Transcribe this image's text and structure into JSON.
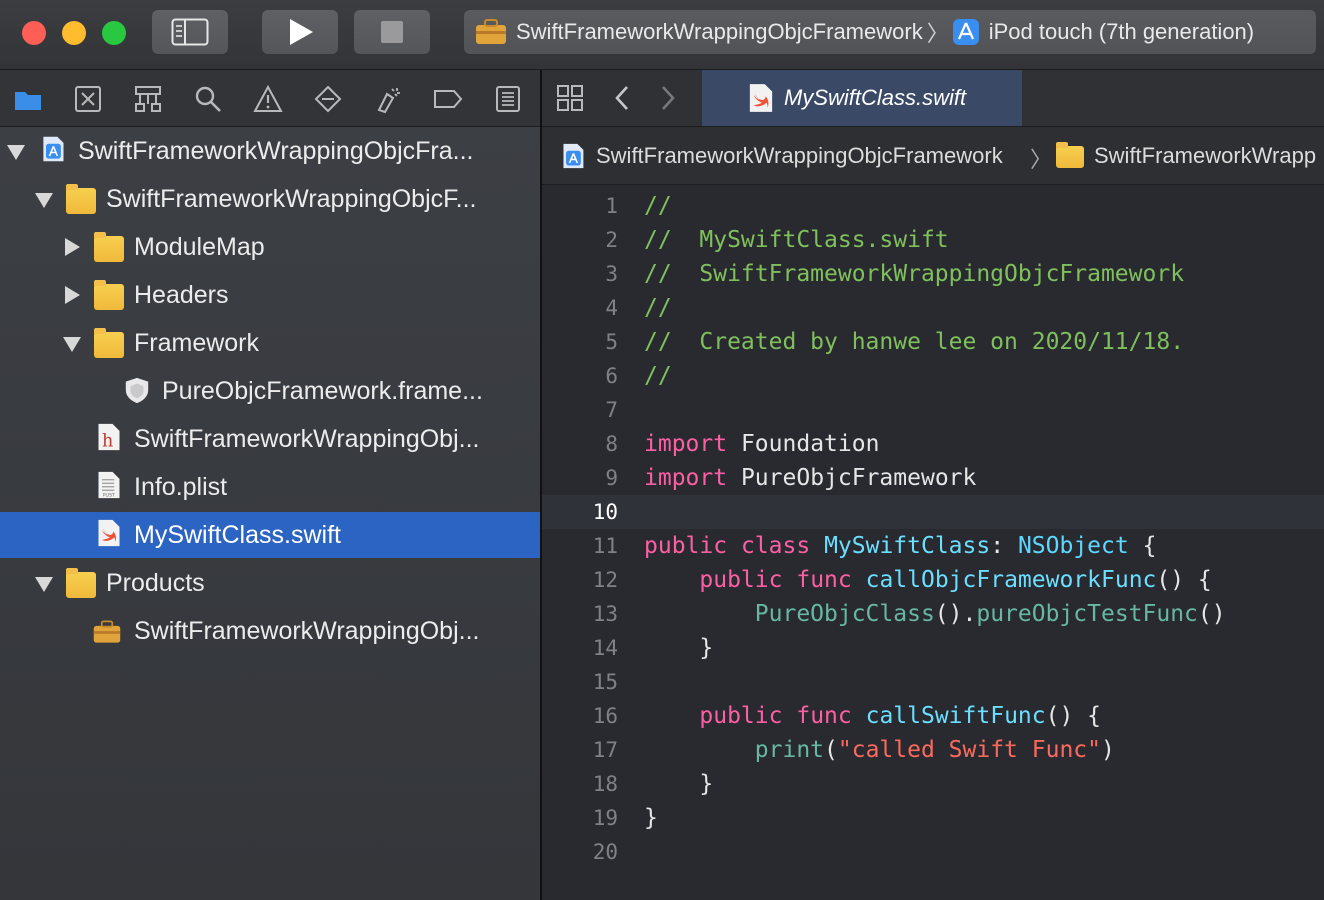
{
  "toolbar": {
    "scheme_name": "SwiftFrameworkWrappingObjcFramework",
    "separator": "〉",
    "device": "iPod touch (7th generation)"
  },
  "navigator": {
    "icons": [
      "folder-icon",
      "source-control-icon",
      "hierarchy-icon",
      "search-icon",
      "warning-icon",
      "test-icon",
      "debug-icon",
      "breakpoint-icon",
      "report-icon"
    ],
    "tree": [
      {
        "label": "SwiftFrameworkWrappingObjcFra...",
        "icon": "project-icon",
        "disclosure": "open"
      },
      {
        "label": "SwiftFrameworkWrappingObjcF...",
        "icon": "folder-icon",
        "disclosure": "open"
      },
      {
        "label": "ModuleMap",
        "icon": "folder-icon",
        "disclosure": "closed"
      },
      {
        "label": "Headers",
        "icon": "folder-icon",
        "disclosure": "closed"
      },
      {
        "label": "Framework",
        "icon": "folder-icon",
        "disclosure": "open"
      },
      {
        "label": "PureObjcFramework.frame...",
        "icon": "framework-icon",
        "disclosure": "none"
      },
      {
        "label": "SwiftFrameworkWrappingObj...",
        "icon": "header-file-icon",
        "disclosure": "none"
      },
      {
        "label": "Info.plist",
        "icon": "plist-file-icon",
        "disclosure": "none"
      },
      {
        "label": "MySwiftClass.swift",
        "icon": "swift-file-icon",
        "disclosure": "none",
        "selected": true
      },
      {
        "label": "Products",
        "icon": "folder-icon",
        "disclosure": "open"
      },
      {
        "label": "SwiftFrameworkWrappingObj...",
        "icon": "product-icon",
        "disclosure": "none"
      }
    ]
  },
  "editor": {
    "tab_title": "MySwiftClass.swift",
    "jump_bar": [
      "SwiftFrameworkWrappingObjcFramework",
      "SwiftFrameworkWrapp"
    ],
    "current_line": 10,
    "lines": [
      {
        "n": "1",
        "code": "//"
      },
      {
        "n": "2",
        "code": "//  MySwiftClass.swift"
      },
      {
        "n": "3",
        "code": "//  SwiftFrameworkWrappingObjcFramework"
      },
      {
        "n": "4",
        "code": "//"
      },
      {
        "n": "5",
        "code": "//  Created by hanwe lee on 2020/11/18."
      },
      {
        "n": "6",
        "code": "//"
      },
      {
        "n": "7",
        "code": ""
      },
      {
        "n": "8",
        "code": "import Foundation"
      },
      {
        "n": "9",
        "code": "import PureObjcFramework"
      },
      {
        "n": "10",
        "code": ""
      },
      {
        "n": "11",
        "code": "public class MySwiftClass: NSObject {"
      },
      {
        "n": "12",
        "code": "    public func callObjcFrameworkFunc() {"
      },
      {
        "n": "13",
        "code": "        PureObjcClass().pureObjcTestFunc()"
      },
      {
        "n": "14",
        "code": "    }"
      },
      {
        "n": "15",
        "code": ""
      },
      {
        "n": "16",
        "code": "    public func callSwiftFunc() {"
      },
      {
        "n": "17",
        "code": "        print(\"called Swift Func\")"
      },
      {
        "n": "18",
        "code": "    }"
      },
      {
        "n": "19",
        "code": "}"
      },
      {
        "n": "20",
        "code": ""
      }
    ]
  },
  "colors": {
    "comment": "#7fc05c",
    "keyword": "#fc5fa3",
    "type": "#5dd8ff",
    "function": "#67b7a4",
    "string": "#fc6a5d",
    "selection": "#2c64c4"
  }
}
